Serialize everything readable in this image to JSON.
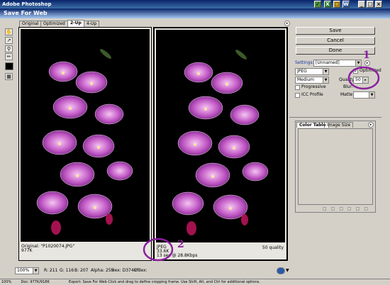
{
  "app": {
    "title": "Adobe Photoshop"
  },
  "dialog": {
    "title": "Save For Web"
  },
  "tabs": [
    "Original",
    "Optimized",
    "2-Up",
    "4-Up"
  ],
  "panes": {
    "left": {
      "line1": "Original: \"P1020074.JPG\"",
      "line2": "977K"
    },
    "right": {
      "line1": "JPEG",
      "line2": "33.6K",
      "line3": "13 sec @ 28.8Kbps",
      "quality": "50 quality"
    }
  },
  "buttons": {
    "save": "Save",
    "cancel": "Cancel",
    "done": "Done"
  },
  "settings": {
    "label": "Settings:",
    "preset": "[Unnamed]",
    "format": "JPEG",
    "quality_level": "Medium",
    "optimized_label": "Optimized",
    "quality_label": "Quality:",
    "quality_value": "50",
    "progressive_label": "Progressive",
    "blur_label": "Blur:",
    "icc_label": "ICC Profile",
    "matte_label": "Matte:"
  },
  "panel_tabs": {
    "color_table": "Color Table",
    "image_size": "Image Size"
  },
  "bottom": {
    "zoom": "100%",
    "r": "R: 211",
    "g": "G: 116",
    "b": "B: 207",
    "alpha": "Alpha: 255",
    "hex": "Hex: D374CF",
    "index": "Index:"
  },
  "status": {
    "zoom": "100%",
    "doc": "Doc: 977K/918K",
    "message": "Export: Save For Web  Click and drag to define cropping frame. Use Shift, Alt, and Ctrl for additional options."
  },
  "annotations": {
    "mark1": "1",
    "mark2": "2"
  },
  "colors": {
    "annotation": "#8a1f9e",
    "titlebar": "#0a246a"
  }
}
